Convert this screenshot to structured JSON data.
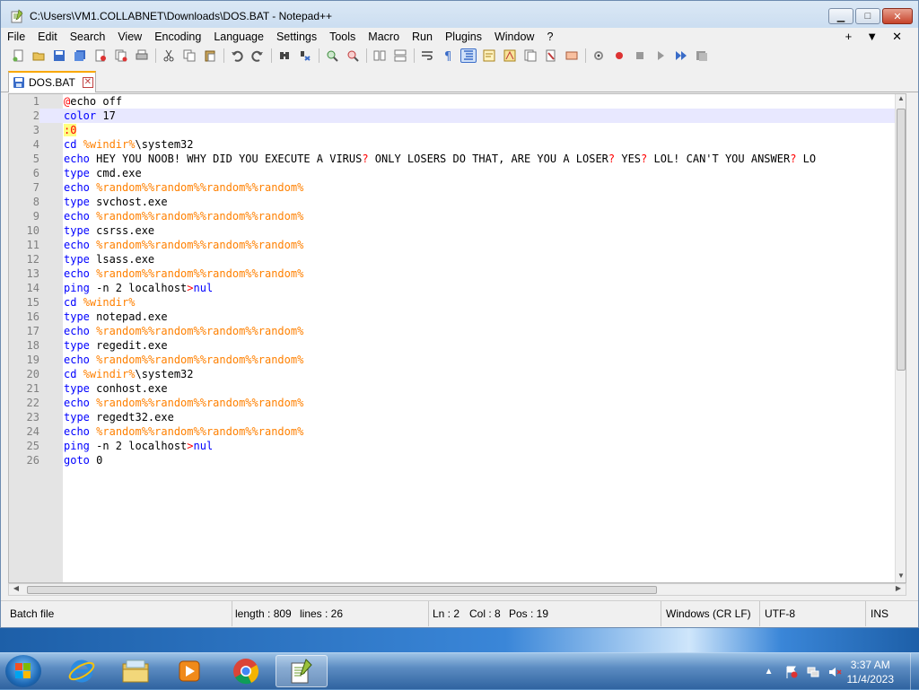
{
  "window": {
    "title": "C:\\Users\\VM1.COLLABNET\\Downloads\\DOS.BAT - Notepad++"
  },
  "menu": [
    "File",
    "Edit",
    "Search",
    "View",
    "Encoding",
    "Language",
    "Settings",
    "Tools",
    "Macro",
    "Run",
    "Plugins",
    "Window",
    "?"
  ],
  "menu_right": [
    "+",
    "▼",
    "✕"
  ],
  "toolbar_icons": [
    "new-file-icon",
    "open-file-icon",
    "save-icon",
    "save-all-icon",
    "close-icon",
    "close-all-icon",
    "print-icon",
    "cut-icon",
    "copy-icon",
    "paste-icon",
    "undo-icon",
    "redo-icon",
    "find-icon",
    "replace-icon",
    "zoom-in-icon",
    "zoom-out-icon",
    "sync-v-icon",
    "sync-h-icon",
    "word-wrap-icon",
    "show-all-chars-icon",
    "indent-guide-icon",
    "udl-icon",
    "doc-map-icon",
    "function-list-icon",
    "folder-workspace-icon",
    "monitor-icon",
    "record-macro-icon",
    "stop-record-icon",
    "play-macro-icon",
    "run-macro-multiple-icon",
    "save-macro-icon"
  ],
  "tab": {
    "label": "DOS.BAT"
  },
  "editor": {
    "current_line": 2,
    "lines": [
      {
        "n": "1",
        "t": "@echo off"
      },
      {
        "n": "2",
        "t": "color 17"
      },
      {
        "n": "3",
        "t": ":0"
      },
      {
        "n": "4",
        "t": "cd %windir%\\system32"
      },
      {
        "n": "5",
        "t": "echo HEY YOU NOOB! WHY DID YOU EXECUTE A VIRUS? ONLY LOSERS DO THAT, ARE YOU A LOSER? YES? LOL! CAN'T YOU ANSWER? LO"
      },
      {
        "n": "6",
        "t": "type cmd.exe"
      },
      {
        "n": "7",
        "t": "echo %random%%random%%random%%random%"
      },
      {
        "n": "8",
        "t": "type svchost.exe"
      },
      {
        "n": "9",
        "t": "echo %random%%random%%random%%random%"
      },
      {
        "n": "10",
        "t": "type csrss.exe"
      },
      {
        "n": "11",
        "t": "echo %random%%random%%random%%random%"
      },
      {
        "n": "12",
        "t": "type lsass.exe"
      },
      {
        "n": "13",
        "t": "echo %random%%random%%random%%random%"
      },
      {
        "n": "14",
        "t": "ping -n 2 localhost>nul"
      },
      {
        "n": "15",
        "t": "cd %windir%"
      },
      {
        "n": "16",
        "t": "type notepad.exe"
      },
      {
        "n": "17",
        "t": "echo %random%%random%%random%%random%"
      },
      {
        "n": "18",
        "t": "type regedit.exe"
      },
      {
        "n": "19",
        "t": "echo %random%%random%%random%%random%"
      },
      {
        "n": "20",
        "t": "cd %windir%\\system32"
      },
      {
        "n": "21",
        "t": "type conhost.exe"
      },
      {
        "n": "22",
        "t": "echo %random%%random%%random%%random%"
      },
      {
        "n": "23",
        "t": "type regedt32.exe"
      },
      {
        "n": "24",
        "t": "echo %random%%random%%random%%random%"
      },
      {
        "n": "25",
        "t": "ping -n 2 localhost>nul"
      },
      {
        "n": "26",
        "t": "goto 0"
      }
    ]
  },
  "status": {
    "type": "Batch file",
    "length": "length : 809",
    "lines": "lines : 26",
    "ln": "Ln : 2",
    "col": "Col : 8",
    "pos": "Pos : 19",
    "eol": "Windows (CR LF)",
    "encoding": "UTF-8",
    "mode": "INS"
  },
  "taskbar": {
    "apps": [
      "start-orb",
      "internet-explorer-icon",
      "file-explorer-icon",
      "media-player-icon",
      "chrome-icon",
      "notepad-plus-plus-icon"
    ],
    "time": "3:37 AM",
    "date": "11/4/2023"
  },
  "colors": {
    "keyword": "#0000ff",
    "variable": "#ff8000",
    "label_bg": "#ffff80",
    "current_line": "#e8e8ff",
    "tab_accent": "#f9a800"
  }
}
